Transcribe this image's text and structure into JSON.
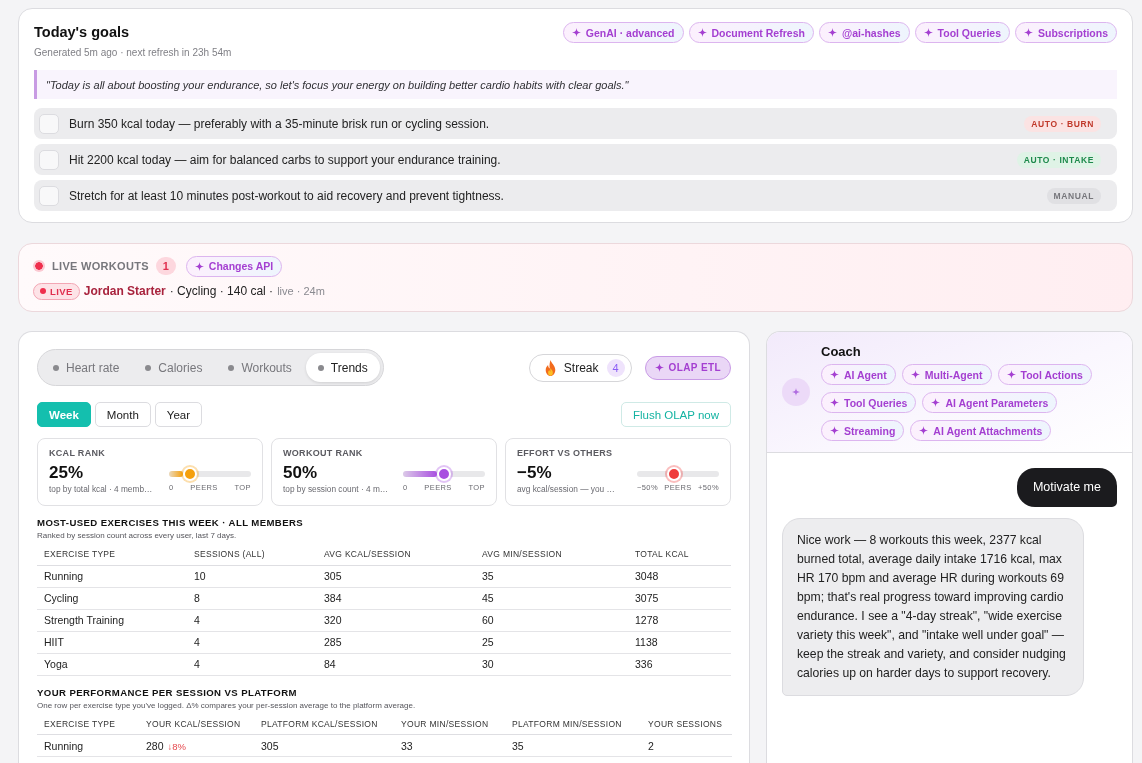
{
  "goals": {
    "title": "Today's goals",
    "meta": "Generated 5m ago · next refresh in 23h 54m",
    "tags": [
      "GenAI · advanced",
      "Document Refresh",
      "@ai-hashes",
      "Tool Queries",
      "Subscriptions"
    ],
    "quote": "\"Today is all about boosting your endurance, so let's focus your energy on building better cardio habits with clear goals.\"",
    "items": [
      {
        "text": "Burn 350 kcal today — preferably with a 35-minute brisk run or cycling session.",
        "checked": false,
        "badge": "AUTO · BURN",
        "kind": "burn"
      },
      {
        "text": "Hit 2200 kcal today — aim for balanced carbs to support your endurance training.",
        "checked": false,
        "badge": "AUTO · INTAKE",
        "kind": "intake"
      },
      {
        "text": "Stretch for at least 10 minutes post-workout to aid recovery and prevent tightness.",
        "checked": false,
        "badge": "MANUAL",
        "kind": "manual"
      }
    ]
  },
  "live_workouts": {
    "title": "LIVE WORKOUTS",
    "count": "1",
    "tag": "Changes API",
    "sessions": [
      {
        "badge": "LIVE",
        "name": "Jordan Starter",
        "details": "· Cycling · 140 cal ·",
        "status": "live · 24m"
      }
    ]
  },
  "dashboard": {
    "tabs": [
      {
        "label": "Heart rate",
        "selected": false
      },
      {
        "label": "Calories",
        "selected": false
      },
      {
        "label": "Workouts",
        "selected": false
      },
      {
        "label": "Trends",
        "selected": true
      }
    ],
    "streak": {
      "label": "Streak",
      "count": "4"
    },
    "tag": "OLAP ETL",
    "periods": [
      {
        "label": "Week",
        "selected": true
      },
      {
        "label": "Month",
        "selected": false
      },
      {
        "label": "Year",
        "selected": false
      }
    ],
    "flush_button": "Flush OLAP now",
    "ranks": [
      {
        "label": "KCAL RANK",
        "value": "25%",
        "caption": "top by total kcal · 4 memb…",
        "kind": "progress",
        "color": "#f5a00c",
        "level": 0.25,
        "scale": [
          "0",
          "PEERS",
          "TOP"
        ]
      },
      {
        "label": "WORKOUT RANK",
        "value": "50%",
        "caption": "top by session count · 4 m…",
        "kind": "progress",
        "color": "#a94fe0",
        "level": 0.5,
        "scale": [
          "0",
          "PEERS",
          "TOP"
        ]
      },
      {
        "label": "EFFORT VS OTHERS",
        "value": "−5%",
        "caption": "avg kcal/session — you …",
        "kind": "diverging",
        "color": "#ef3b3b",
        "level": 0.45,
        "scale": [
          "−50%",
          "PEERS",
          "+50%"
        ]
      }
    ],
    "tables": [
      {
        "title": "MOST-USED EXERCISES THIS WEEK · ALL MEMBERS",
        "subtitle": "Ranked by session count across every user, last 7 days.",
        "columns": [
          "EXERCISE TYPE",
          "SESSIONS (ALL)",
          "AVG KCAL/SESSION",
          "AVG MIN/SESSION",
          "TOTAL KCAL"
        ],
        "rows": [
          [
            "Running",
            "10",
            "305",
            "35",
            "3048"
          ],
          [
            "Cycling",
            "8",
            "384",
            "45",
            "3075"
          ],
          [
            "Strength Training",
            "4",
            "320",
            "60",
            "1278"
          ],
          [
            "HIIT",
            "4",
            "285",
            "25",
            "1138"
          ],
          [
            "Yoga",
            "4",
            "84",
            "30",
            "336"
          ]
        ]
      },
      {
        "title": "YOUR PERFORMANCE PER SESSION VS PLATFORM",
        "subtitle": "One row per exercise type you've logged. Δ% compares your per-session average to the platform average.",
        "columns": [
          "EXERCISE TYPE",
          "YOUR KCAL/SESSION",
          "PLATFORM KCAL/SESSION",
          "YOUR MIN/SESSION",
          "PLATFORM MIN/SESSION",
          "YOUR SESSIONS"
        ],
        "rows": [
          [
            "Running",
            {
              "text": "280",
              "delta": "↓8%"
            },
            "305",
            "33",
            "35",
            "2"
          ]
        ]
      }
    ]
  },
  "coach": {
    "title": "Coach",
    "tags": [
      "AI Agent",
      "Multi-Agent",
      "Tool Actions",
      "Tool Queries",
      "AI Agent Parameters",
      "Streaming",
      "AI Agent Attachments"
    ],
    "messages": [
      {
        "kind": "user",
        "text": "Motivate me"
      },
      {
        "kind": "assistant",
        "text": "Nice work — 8 workouts this week, 2377 kcal burned total, average daily intake 1716 kcal, max HR 170 bpm and average HR during workouts 69 bpm; that's real progress toward improving cardio endurance. I see a \"4-day streak\", \"wide exercise variety this week\", and \"intake well under goal\" — keep the streak and variety, and consider nudging calories up on harder days to support recovery."
      }
    ]
  }
}
